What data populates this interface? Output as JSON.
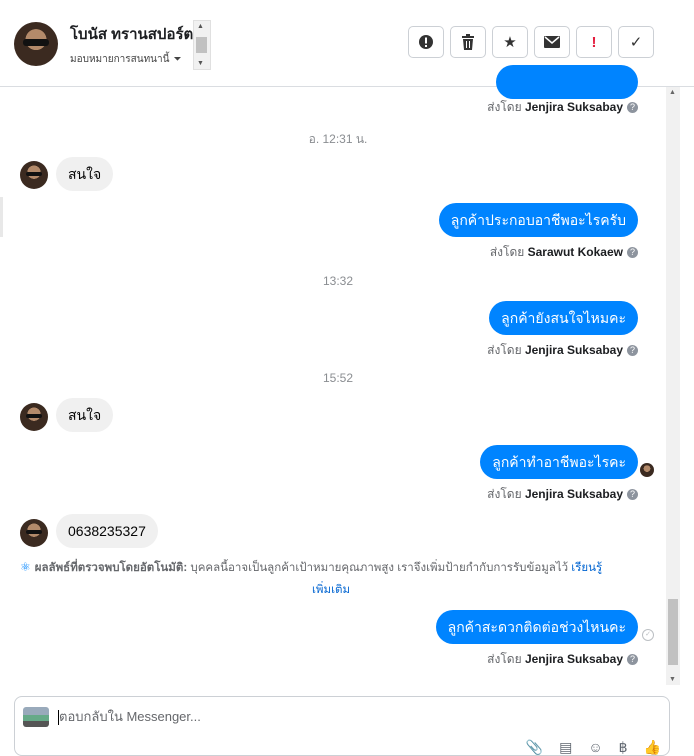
{
  "header": {
    "contact_name": "โบนัส ทรานสปอร์ต",
    "assign_label": "มอบหมายการสนทนานี้",
    "caret": "⏷",
    "actions": [
      {
        "name": "spam-button",
        "glyph": "⓵"
      },
      {
        "name": "delete-button",
        "glyph": "🗑"
      },
      {
        "name": "star-button",
        "glyph": "★"
      },
      {
        "name": "mark-unread-button",
        "glyph": "✉"
      },
      {
        "name": "mark-important-button",
        "glyph": "!"
      },
      {
        "name": "mark-done-button",
        "glyph": "✓"
      }
    ]
  },
  "messages": {
    "sent_by_prefix": "ส่งโดย",
    "q": "?",
    "top_sender": "Jenjira Suksabay",
    "ts1": "อ. 12:31 น.",
    "in1": "สนใจ",
    "out1": "ลูกค้าประกอบอาชีพอะไรครับ",
    "out1_sender": "Sarawut Kokaew",
    "ts2": "13:32",
    "out2": "ลูกค้ายังสนใจไหมคะ",
    "out2_sender": "Jenjira Suksabay",
    "ts3": "15:52",
    "in2": "สนใจ",
    "out3": "ลูกค้าทำอาชีพอะไรคะ",
    "out3_sender": "Jenjira Suksabay",
    "in3": "0638235327",
    "ai_title": "ผลลัพธ์ที่ตรวจพบโดยอัตโนมัติ:",
    "ai_text": "บุคคลนี้อาจเป็นลูกค้าเป้าหมายคุณภาพสูง เราจึงเพิ่มป้ายกำกับการรับข้อมูลไว้",
    "ai_more_1": "เรียนรู้",
    "ai_more_2": "เพิ่มเติม",
    "out4": "ลูกค้าสะดวกติดต่อช่วงไหนคะ",
    "out4_sender": "Jenjira Suksabay"
  },
  "composer": {
    "placeholder": "ตอบกลับใน Messenger..."
  }
}
